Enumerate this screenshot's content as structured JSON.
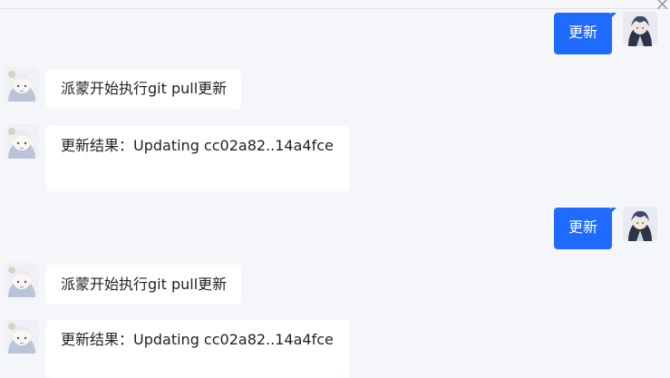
{
  "window": {
    "close_glyph": "×"
  },
  "messages": [
    {
      "side": "right",
      "text": "更新",
      "avatar": "user-avatar"
    },
    {
      "side": "left",
      "text": "派蒙开始执行git pull更新",
      "avatar": "bot-avatar"
    },
    {
      "side": "left",
      "text": "更新结果：Updating cc02a82..14a4fce",
      "avatar": "bot-avatar"
    },
    {
      "side": "right",
      "text": "更新",
      "avatar": "user-avatar"
    },
    {
      "side": "left",
      "text": "派蒙开始执行git pull更新",
      "avatar": "bot-avatar"
    },
    {
      "side": "left",
      "text": "更新结果：Updating cc02a82..14a4fce",
      "avatar": "bot-avatar"
    }
  ],
  "colors": {
    "background": "#f5f6f9",
    "user_bubble": "#1f6bff",
    "bot_bubble": "#ffffff"
  }
}
